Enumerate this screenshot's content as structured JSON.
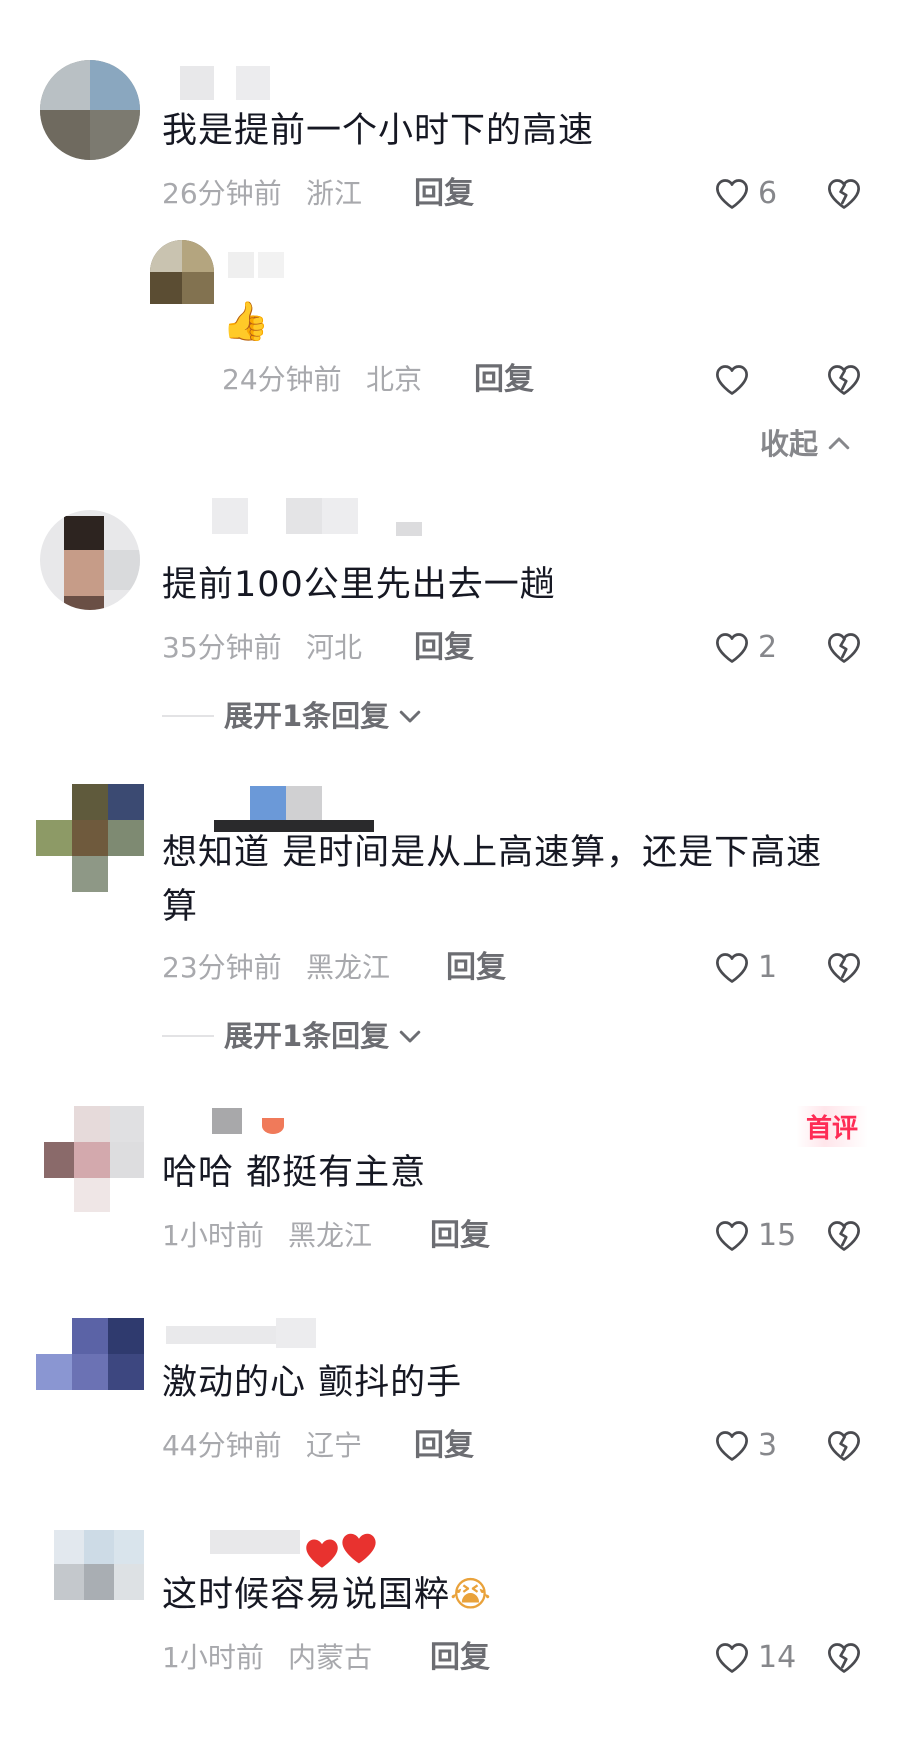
{
  "colors": {
    "text_primary": "#161823",
    "text_meta": "#a8a9ad",
    "reply": "#6c6d72",
    "accent_badge": "#fe2c55",
    "heart_red": "#e8322f"
  },
  "icons": {
    "like": "heart-outline-icon",
    "dislike": "broken-heart-icon",
    "expand": "chevron-down-icon",
    "collapse": "chevron-up-icon"
  },
  "comments": [
    {
      "text": "我是提前一个小时下的高速",
      "time": "26分钟前",
      "location": "浙江",
      "reply_label": "回复",
      "likes": "6",
      "replies": [
        {
          "text": "👍",
          "time": "24分钟前",
          "location": "北京",
          "reply_label": "回复",
          "likes": ""
        }
      ],
      "collapse_label": "收起"
    },
    {
      "text": "提前100公里先出去一趟",
      "time": "35分钟前",
      "location": "河北",
      "reply_label": "回复",
      "likes": "2",
      "expand_label": "展开1条回复"
    },
    {
      "text": "想知道 是时间是从上高速算，还是下高速算",
      "time": "23分钟前",
      "location": "黑龙江",
      "reply_label": "回复",
      "likes": "1",
      "expand_label": "展开1条回复"
    },
    {
      "text": "哈哈 都挺有主意",
      "badge": "首评",
      "time": "1小时前",
      "location": "黑龙江",
      "reply_label": "回复",
      "likes": "15"
    },
    {
      "text": "激动的心 颤抖的手",
      "time": "44分钟前",
      "location": "辽宁",
      "reply_label": "回复",
      "likes": "3"
    },
    {
      "text": "这时候容易说国粹",
      "text_emoji": "😭",
      "time": "1小时前",
      "location": "内蒙古",
      "reply_label": "回复",
      "likes": "14"
    }
  ]
}
